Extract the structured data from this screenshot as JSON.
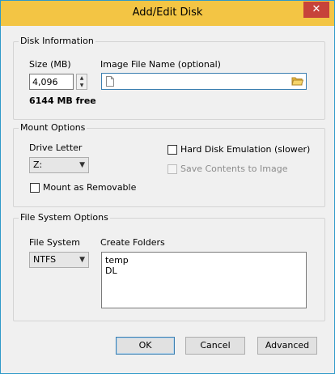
{
  "window": {
    "title": "Add/Edit Disk",
    "close_glyph": "✕"
  },
  "disk_information": {
    "group_label": "Disk Information",
    "size_label": "Size (MB)",
    "size_value": "4,096",
    "free_text": "6144 MB free",
    "image_label": "Image File Name (optional)",
    "image_value": ""
  },
  "mount_options": {
    "group_label": "Mount Options",
    "drive_letter_label": "Drive Letter",
    "drive_letter_value": "Z:",
    "mount_removable_label": "Mount as Removable",
    "hard_disk_label": "Hard Disk Emulation (slower)",
    "save_contents_label": "Save Contents to Image"
  },
  "fs_options": {
    "group_label": "File System Options",
    "fs_label": "File System",
    "fs_value": "NTFS",
    "create_folders_label": "Create Folders",
    "folders": [
      "temp",
      "DL"
    ]
  },
  "buttons": {
    "ok": "OK",
    "cancel": "Cancel",
    "advanced": "Advanced"
  },
  "colors": {
    "titlebar": "#f3c544",
    "close": "#c7433a",
    "window_border": "#2f9ac9"
  }
}
